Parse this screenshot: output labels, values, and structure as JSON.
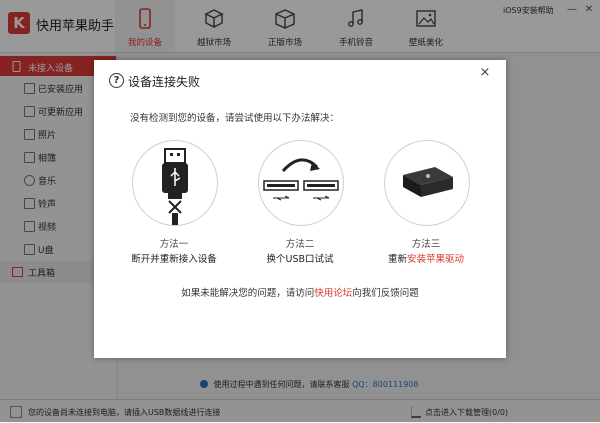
{
  "app": {
    "logo_letter": "K",
    "title": "快用苹果助手"
  },
  "tabs": [
    {
      "label": "我的设备",
      "icon": "phone-icon",
      "active": true
    },
    {
      "label": "越狱市场",
      "icon": "cubes-icon"
    },
    {
      "label": "正版市场",
      "icon": "box-icon"
    },
    {
      "label": "手机铃音",
      "icon": "music-note-icon"
    },
    {
      "label": "壁纸美化",
      "icon": "picture-icon"
    }
  ],
  "header": {
    "help_link": "iOS9安装帮助",
    "minimize": "—",
    "close": "✕"
  },
  "sidebar": {
    "header": "未接入设备",
    "items": [
      {
        "label": "已安装应用",
        "icon": "apps-icon"
      },
      {
        "label": "可更新应用",
        "icon": "update-icon"
      },
      {
        "label": "照片",
        "icon": "photo-icon"
      },
      {
        "label": "相簿",
        "icon": "album-icon"
      },
      {
        "label": "音乐",
        "icon": "music-icon"
      },
      {
        "label": "铃声",
        "icon": "bell-icon"
      },
      {
        "label": "视频",
        "icon": "video-icon"
      },
      {
        "label": "U盘",
        "icon": "usb-drive-icon"
      }
    ],
    "tools": "工具箱"
  },
  "dialog": {
    "title": "设备连接失败",
    "title_icon": "?",
    "close": "×",
    "description": "没有检测到您的设备，请尝试使用以下办法解决：",
    "methods": [
      {
        "title": "方法一",
        "desc": "断开并重新接入设备",
        "icon": "usb-cable-icon"
      },
      {
        "title": "方法二",
        "desc": "换个USB口试试",
        "icon": "usb-ports-icon"
      },
      {
        "title": "方法三",
        "desc_prefix": "重新",
        "desc_link": "安装苹果驱动",
        "icon": "device-box-icon"
      }
    ],
    "footer_prefix": "如果未能解决您的问题，请访问",
    "footer_link": "快用论坛",
    "footer_suffix": "向我们反馈问题"
  },
  "support": {
    "text": "使用过程中遇到任何问题，请联系客服",
    "qq": "QQ：800111908"
  },
  "status": {
    "left": "您的设备尚未连接到电脑，请插入USB数据线进行连接",
    "download": "点击进入下载管理(0/0)"
  },
  "colors": {
    "accent": "#e03a3a",
    "link": "#d43a2f",
    "qq": "#2a6fc9"
  }
}
